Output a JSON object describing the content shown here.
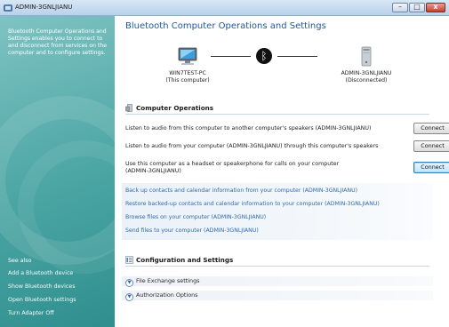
{
  "window": {
    "title": "ADMIN-3GNLJIANU",
    "minimize_glyph": "–",
    "maximize_glyph": "□",
    "close_glyph": "x"
  },
  "sidebar": {
    "description": "Bluetooth Computer Operations and Settings enables you to connect to and disconnect from services on the computer and to configure settings.",
    "see_also": "See also",
    "links": [
      "Add a Bluetooth device",
      "Show Bluetooth devices",
      "Open Bluetooth settings",
      "Turn Adapter Off"
    ]
  },
  "main": {
    "heading": "Bluetooth Computer Operations and Settings",
    "local_device": {
      "name": "WIN7TEST-PC",
      "status": "(This computer)"
    },
    "remote_device": {
      "name": "ADMIN-3GNLJIANU",
      "status": "(Disconnected)"
    },
    "bluetooth_glyph": "ᛒ"
  },
  "operations": {
    "title": "Computer Operations",
    "rows": [
      {
        "text": "Listen to audio from this computer to another computer's speakers (ADMIN-3GNLJIANU)",
        "button": "Connect"
      },
      {
        "text": "Listen to audio from your computer (ADMIN-3GNLJIANU) through this computer's speakers",
        "button": "Connect"
      },
      {
        "text": "Use this computer as a headset or speakerphone for calls on your computer (ADMIN-3GNLJIANU)",
        "button": "Connect"
      }
    ],
    "links": [
      "Back up contacts and calendar information from your computer (ADMIN-3GNLJIANU)",
      "Restore backed-up contacts and calendar information to your computer (ADMIN-3GNLJIANU)",
      "Browse files on your computer (ADMIN-3GNLJIANU)",
      "Send files to your computer (ADMIN-3GNLJIANU)"
    ]
  },
  "config": {
    "title": "Configuration and Settings",
    "expanders": [
      "File Exchange settings",
      "Authorization Options"
    ]
  },
  "icons": {
    "app": "bluetooth-app-icon",
    "local": "computer-icon",
    "remote": "pc-tower-icon",
    "operations": "operations-icon",
    "config": "settings-icon",
    "expander": "chevron-down-icon"
  }
}
